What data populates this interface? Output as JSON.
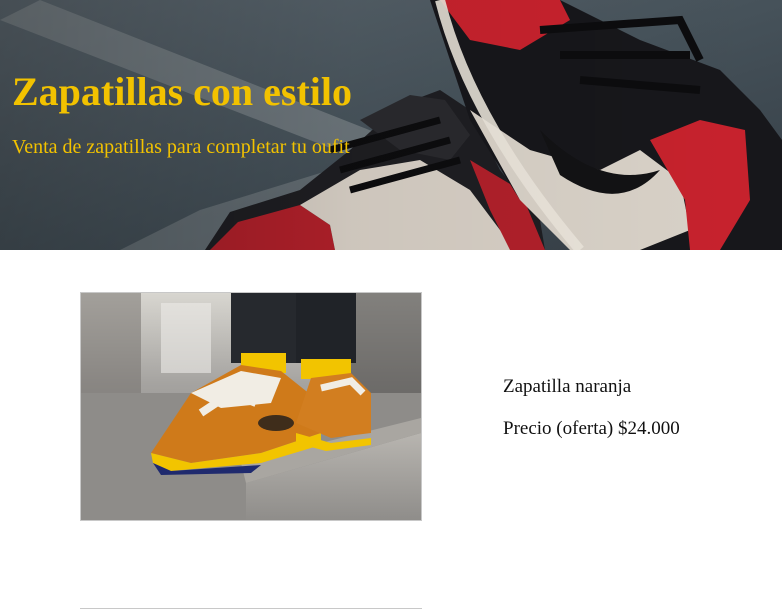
{
  "hero": {
    "title": "Zapatillas con estilo",
    "subtitle": "Venta de zapatillas para completar tu oufit"
  },
  "products": [
    {
      "name": "Zapatilla naranja",
      "price": "Precio (oferta) $24.000"
    }
  ],
  "colors": {
    "hero_text": "#f2c200",
    "body_text": "#111111",
    "card_border": "#c8c8c8"
  }
}
